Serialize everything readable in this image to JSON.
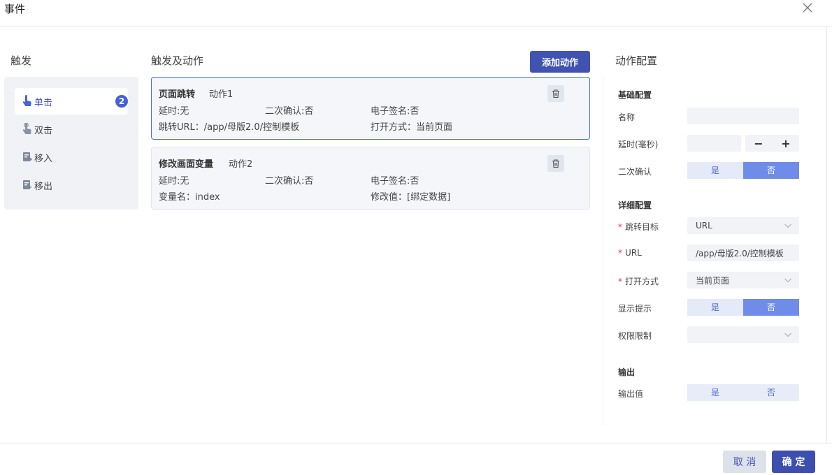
{
  "dialog": {
    "title": "事件"
  },
  "trigger": {
    "title": "触发",
    "items": [
      {
        "label": "单击",
        "badge": "2",
        "active": true
      },
      {
        "label": "双击"
      },
      {
        "label": "移入"
      },
      {
        "label": "移出"
      }
    ]
  },
  "actions": {
    "title": "触发及动作",
    "add_label": "添加动作",
    "cards": [
      {
        "name": "页面跳转",
        "index": "动作1",
        "delay": "延时:无",
        "confirm": "二次确认:否",
        "signature": "电子签名:否",
        "detail_left": "跳转URL：/app/母版2.0/控制模板",
        "detail_right": "打开方式：当前页面"
      },
      {
        "name": "修改画面变量",
        "index": "动作2",
        "delay": "延时:无",
        "confirm": "二次确认:否",
        "signature": "电子签名:否",
        "detail_left": "变量名：index",
        "detail_right": "修改值：[绑定数据]"
      }
    ]
  },
  "config": {
    "title": "动作配置",
    "basic": {
      "title": "基础配置",
      "name_label": "名称",
      "name_value": "",
      "delay_label": "延时(毫秒)",
      "delay_value": "",
      "minus": "−",
      "plus": "+",
      "confirm_label": "二次确认",
      "yes": "是",
      "no": "否"
    },
    "detail": {
      "title": "详细配置",
      "target_label": "跳转目标",
      "target_value": "URL",
      "url_label": "URL",
      "url_value": "/app/母版2.0/控制模板",
      "open_label": "打开方式",
      "open_value": "当前页面",
      "tip_label": "显示提示",
      "yes": "是",
      "no": "否",
      "perm_label": "权限限制",
      "perm_value": ""
    },
    "output": {
      "title": "输出",
      "value_label": "输出值",
      "yes": "是",
      "no": "否"
    }
  },
  "footer": {
    "cancel_label": "取 消",
    "ok_label": "确 定"
  },
  "colors": {
    "accent": "#4053b1",
    "toggle_on": "#6f8ce8",
    "required": "#e23b3b"
  }
}
